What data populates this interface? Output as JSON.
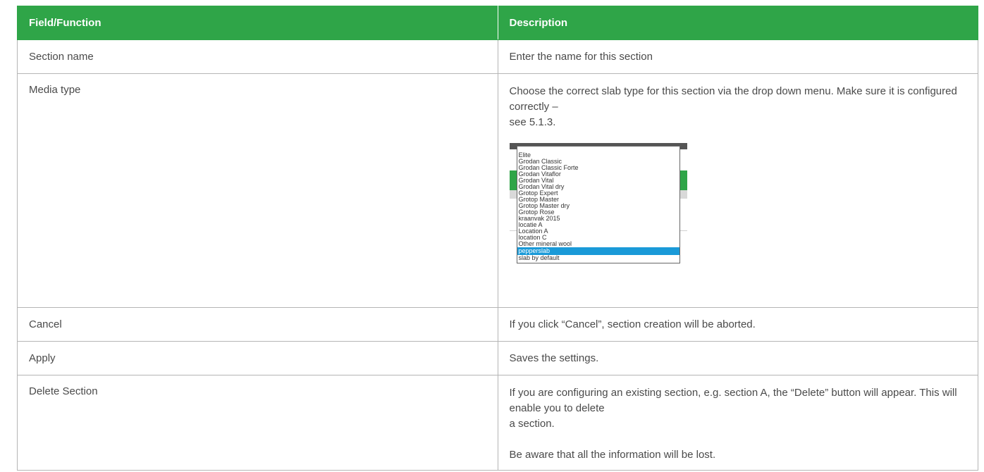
{
  "table": {
    "headers": [
      "Field/Function",
      "Description"
    ],
    "rows": [
      {
        "field": "Section name",
        "description": [
          "Enter the name for this section"
        ]
      },
      {
        "field": "Media type",
        "description": [
          "Choose the correct slab type for this section via the drop down menu. Make sure it is configured correctly –",
          "see 5.1.3."
        ]
      },
      {
        "field": "Cancel",
        "description": [
          "If you click “Cancel”, section creation will be aborted."
        ]
      },
      {
        "field": "Apply",
        "description": [
          "Saves the settings."
        ]
      },
      {
        "field": "Delete Section",
        "description": [
          "If you are configuring an existing section, e.g. section A, the “Delete” button will appear. This will enable you to delete",
          "a section.",
          "Be aware that all the information will be lost."
        ]
      }
    ]
  },
  "dropdown": {
    "options": [
      "Elite",
      "Grodan Classic",
      "Grodan Classic Forte",
      "Grodan Vitaflor",
      "Grodan Vital",
      "Grodan Vital dry",
      "Grotop Expert",
      "Grotop Master",
      "Grotop Master dry",
      "Grotop Rose",
      "kraanvak 2015",
      "locatie A",
      "Location A",
      "location C",
      "Other mineral wool",
      "pepperslab",
      "slab by default"
    ],
    "selected_index": 15,
    "colors": {
      "selected": "#1a9ad8",
      "header": "#2fa548"
    }
  }
}
